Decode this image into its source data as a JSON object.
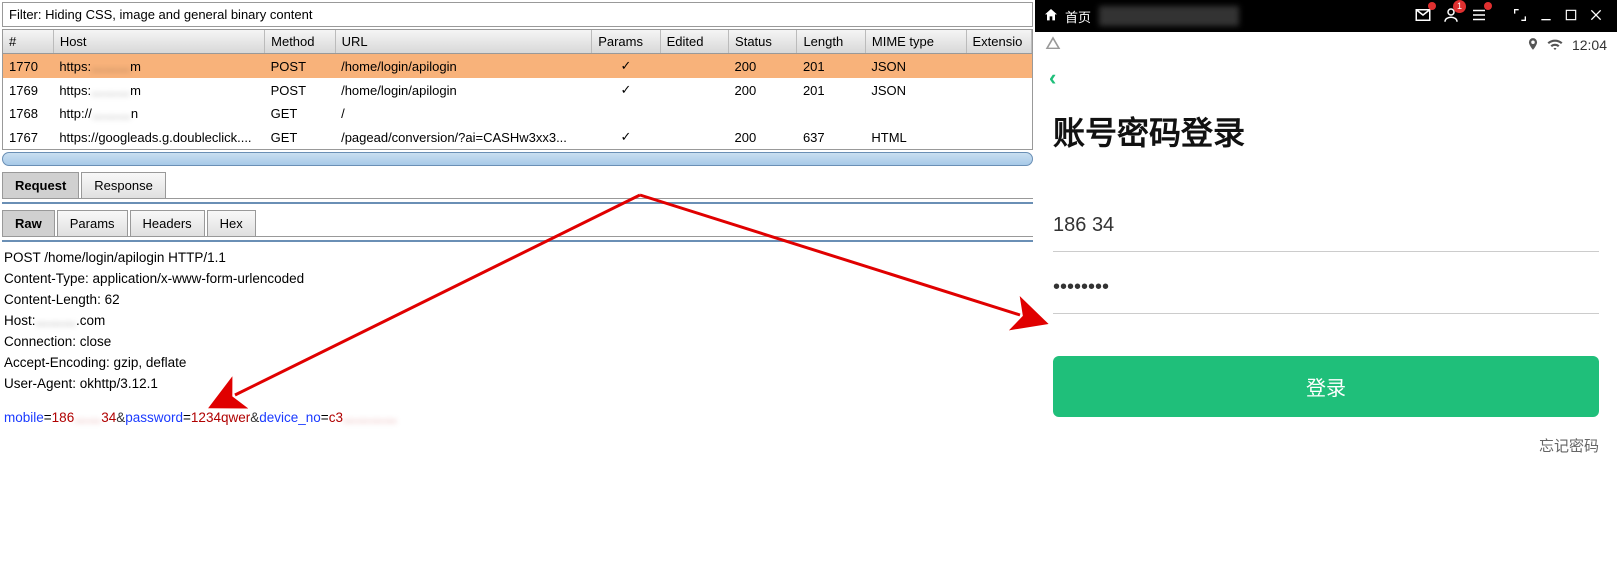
{
  "filter": {
    "text": "Filter: Hiding CSS, image and general binary content"
  },
  "columns": {
    "num": "#",
    "host": "Host",
    "method": "Method",
    "url": "URL",
    "params": "Params",
    "edited": "Edited",
    "status": "Status",
    "length": "Length",
    "mime": "MIME type",
    "ext": "Extensio"
  },
  "rows": [
    {
      "num": "1770",
      "host_prefix": "https:",
      "host_blur": "………",
      "host_suffix": "m",
      "method": "POST",
      "url": "/home/login/apilogin",
      "params": "✓",
      "edited": "",
      "status": "200",
      "length": "201",
      "mime": "JSON",
      "ext": "",
      "selected": true
    },
    {
      "num": "1769",
      "host_prefix": "https:",
      "host_blur": "………",
      "host_suffix": "m",
      "method": "POST",
      "url": "/home/login/apilogin",
      "params": "✓",
      "edited": "",
      "status": "200",
      "length": "201",
      "mime": "JSON",
      "ext": "",
      "selected": false
    },
    {
      "num": "1768",
      "host_prefix": "http://",
      "host_blur": "………",
      "host_suffix": "n",
      "method": "GET",
      "url": "/",
      "params": "",
      "edited": "",
      "status": "",
      "length": "",
      "mime": "",
      "ext": "",
      "selected": false
    },
    {
      "num": "1767",
      "host_prefix": "https://googleads.g.doubleclick....",
      "host_blur": "",
      "host_suffix": "",
      "method": "GET",
      "url": "/pagead/conversion/?ai=CASHw3xx3...",
      "params": "✓",
      "edited": "",
      "status": "200",
      "length": "637",
      "mime": "HTML",
      "ext": "",
      "selected": false
    }
  ],
  "tabs1": {
    "request": "Request",
    "response": "Response"
  },
  "tabs2": {
    "raw": "Raw",
    "params": "Params",
    "headers": "Headers",
    "hex": "Hex"
  },
  "raw": {
    "l1": "POST /home/login/apilogin HTTP/1.1",
    "l2": "Content-Type: application/x-www-form-urlencoded",
    "l3": "Content-Length: 62",
    "l4a": "Host:",
    "l4blur": "………",
    "l4b": ".com",
    "l5": "Connection: close",
    "l6": "Accept-Encoding: gzip, deflate",
    "l7": "User-Agent: okhttp/3.12.1"
  },
  "body": {
    "k1": "mobile",
    "eq": "=",
    "v1a": "186",
    "v1blur": "……",
    "v1b": "34",
    "amp1": "&",
    "k2": "password",
    "v2": "1234qwer",
    "amp2": "&",
    "k3": "device_no",
    "v3a": "c3",
    "v3blur": "…………"
  },
  "mobile": {
    "home": "首页",
    "time": "12:04",
    "title": "账号密码登录",
    "phone_prefix": "186",
    "phone_blur": "     ",
    "phone_suffix": "34",
    "pwd": "••••••••",
    "login_btn": "登录",
    "forgot": "忘记密码",
    "notif_count": "1"
  }
}
